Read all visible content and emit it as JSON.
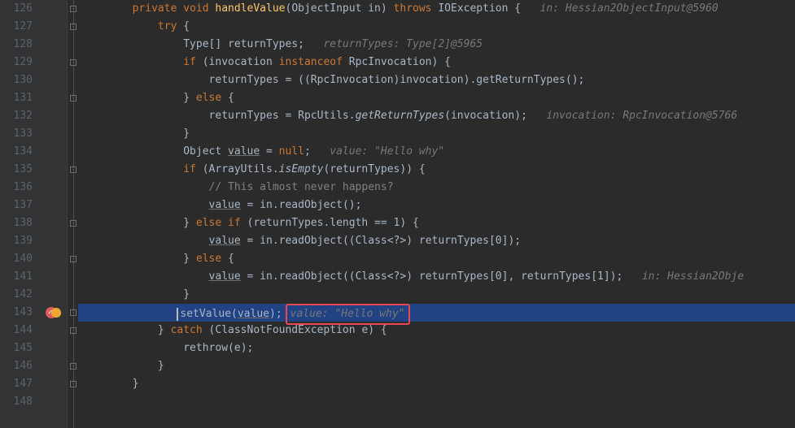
{
  "editor": {
    "first_line": 126,
    "last_line": 148,
    "breakpoint_line": 143,
    "caret_line": 143,
    "lines": {
      "126": {
        "indent": 8,
        "tokens": [
          [
            "kw",
            "private"
          ],
          [
            "pun",
            " "
          ],
          [
            "kw",
            "void"
          ],
          [
            "pun",
            " "
          ],
          [
            "method-decl",
            "handleValue"
          ],
          [
            "pun",
            "("
          ],
          [
            "type",
            "ObjectInput"
          ],
          [
            "pun",
            " "
          ],
          [
            "param",
            "in"
          ],
          [
            "pun",
            ") "
          ],
          [
            "kw",
            "throws"
          ],
          [
            "pun",
            " "
          ],
          [
            "type",
            "IOException"
          ],
          [
            "pun",
            " {   "
          ]
        ],
        "hint": "in: Hessian2ObjectInput@5960"
      },
      "127": {
        "indent": 12,
        "tokens": [
          [
            "kw",
            "try"
          ],
          [
            "pun",
            " {"
          ]
        ]
      },
      "128": {
        "indent": 16,
        "tokens": [
          [
            "type",
            "Type"
          ],
          [
            "pun",
            "[] "
          ],
          [
            "ident",
            "returnTypes"
          ],
          [
            "pun",
            ";   "
          ]
        ],
        "hint": "returnTypes: Type[2]@5965"
      },
      "129": {
        "indent": 16,
        "tokens": [
          [
            "kw",
            "if"
          ],
          [
            "pun",
            " ("
          ],
          [
            "ident",
            "invocation"
          ],
          [
            "pun",
            " "
          ],
          [
            "kw",
            "instanceof"
          ],
          [
            "pun",
            " "
          ],
          [
            "type",
            "RpcInvocation"
          ],
          [
            "pun",
            ") {"
          ]
        ]
      },
      "130": {
        "indent": 20,
        "tokens": [
          [
            "ident",
            "returnTypes"
          ],
          [
            "pun",
            " = (("
          ],
          [
            "type",
            "RpcInvocation"
          ],
          [
            "pun",
            ")"
          ],
          [
            "ident",
            "invocation"
          ],
          [
            "pun",
            ")."
          ],
          [
            "method-call",
            "getReturnTypes"
          ],
          [
            "pun",
            "();"
          ]
        ]
      },
      "131": {
        "indent": 16,
        "tokens": [
          [
            "pun",
            "} "
          ],
          [
            "kw",
            "else"
          ],
          [
            "pun",
            " {"
          ]
        ]
      },
      "132": {
        "indent": 20,
        "tokens": [
          [
            "ident",
            "returnTypes"
          ],
          [
            "pun",
            " = "
          ],
          [
            "type",
            "RpcUtils"
          ],
          [
            "pun",
            "."
          ],
          [
            "method-static",
            "getReturnTypes"
          ],
          [
            "pun",
            "("
          ],
          [
            "ident",
            "invocation"
          ],
          [
            "pun",
            ");   "
          ]
        ],
        "hint": "invocation: RpcInvocation@5766"
      },
      "133": {
        "indent": 16,
        "tokens": [
          [
            "pun",
            "}"
          ]
        ]
      },
      "134": {
        "indent": 16,
        "tokens": [
          [
            "type",
            "Object"
          ],
          [
            "pun",
            " "
          ],
          [
            "ident-u",
            "value"
          ],
          [
            "pun",
            " = "
          ],
          [
            "kw",
            "null"
          ],
          [
            "pun",
            ";   "
          ]
        ],
        "hint": "value: \"Hello why\""
      },
      "135": {
        "indent": 16,
        "tokens": [
          [
            "kw",
            "if"
          ],
          [
            "pun",
            " ("
          ],
          [
            "type",
            "ArrayUtils"
          ],
          [
            "pun",
            "."
          ],
          [
            "method-static",
            "isEmpty"
          ],
          [
            "pun",
            "("
          ],
          [
            "ident",
            "returnTypes"
          ],
          [
            "pun",
            ")) {"
          ]
        ]
      },
      "136": {
        "indent": 20,
        "tokens": [
          [
            "comment",
            "// This almost never happens?"
          ]
        ]
      },
      "137": {
        "indent": 20,
        "tokens": [
          [
            "ident-u",
            "value"
          ],
          [
            "pun",
            " = "
          ],
          [
            "ident",
            "in"
          ],
          [
            "pun",
            "."
          ],
          [
            "method-call",
            "readObject"
          ],
          [
            "pun",
            "();"
          ]
        ]
      },
      "138": {
        "indent": 16,
        "tokens": [
          [
            "pun",
            "} "
          ],
          [
            "kw",
            "else if"
          ],
          [
            "pun",
            " ("
          ],
          [
            "ident",
            "returnTypes"
          ],
          [
            "pun",
            "."
          ],
          [
            "ident",
            "length"
          ],
          [
            "pun",
            " == "
          ],
          [
            "num",
            "1"
          ],
          [
            "pun",
            ") {"
          ]
        ]
      },
      "139": {
        "indent": 20,
        "tokens": [
          [
            "ident-u",
            "value"
          ],
          [
            "pun",
            " = "
          ],
          [
            "ident",
            "in"
          ],
          [
            "pun",
            "."
          ],
          [
            "method-call",
            "readObject"
          ],
          [
            "pun",
            "(("
          ],
          [
            "type",
            "Class<?>"
          ],
          [
            "pun",
            ") "
          ],
          [
            "ident",
            "returnTypes"
          ],
          [
            "pun",
            "["
          ],
          [
            "num",
            "0"
          ],
          [
            "pun",
            "]);"
          ]
        ]
      },
      "140": {
        "indent": 16,
        "tokens": [
          [
            "pun",
            "} "
          ],
          [
            "kw",
            "else"
          ],
          [
            "pun",
            " {"
          ]
        ]
      },
      "141": {
        "indent": 20,
        "tokens": [
          [
            "ident-u",
            "value"
          ],
          [
            "pun",
            " = "
          ],
          [
            "ident",
            "in"
          ],
          [
            "pun",
            "."
          ],
          [
            "method-call",
            "readObject"
          ],
          [
            "pun",
            "(("
          ],
          [
            "type",
            "Class<?>"
          ],
          [
            "pun",
            ") "
          ],
          [
            "ident",
            "returnTypes"
          ],
          [
            "pun",
            "["
          ],
          [
            "num",
            "0"
          ],
          [
            "pun",
            "], "
          ],
          [
            "ident",
            "returnTypes"
          ],
          [
            "pun",
            "["
          ],
          [
            "num",
            "1"
          ],
          [
            "pun",
            "]);   "
          ]
        ],
        "hint": "in: Hessian2Obje"
      },
      "142": {
        "indent": 16,
        "tokens": [
          [
            "pun",
            "}"
          ]
        ]
      },
      "143": {
        "indent": 16,
        "tokens": [
          [
            "method-call",
            "setValue"
          ],
          [
            "pun",
            "("
          ],
          [
            "ident-u",
            "value"
          ],
          [
            "pun",
            ");"
          ]
        ],
        "boxhint": "value: \"Hello why\"",
        "highlighted": true,
        "caret": true
      },
      "144": {
        "indent": 12,
        "tokens": [
          [
            "pun",
            "} "
          ],
          [
            "kw",
            "catch"
          ],
          [
            "pun",
            " ("
          ],
          [
            "type",
            "ClassNotFoundException"
          ],
          [
            "pun",
            " "
          ],
          [
            "param",
            "e"
          ],
          [
            "pun",
            ") {"
          ]
        ]
      },
      "145": {
        "indent": 16,
        "tokens": [
          [
            "method-call",
            "rethrow"
          ],
          [
            "pun",
            "("
          ],
          [
            "ident",
            "e"
          ],
          [
            "pun",
            ");"
          ]
        ]
      },
      "146": {
        "indent": 12,
        "tokens": [
          [
            "pun",
            "}"
          ]
        ]
      },
      "147": {
        "indent": 8,
        "tokens": [
          [
            "pun",
            "}"
          ]
        ]
      },
      "148": {
        "indent": 0,
        "tokens": []
      }
    }
  },
  "fold_markers": [
    126,
    127,
    129,
    131,
    135,
    138,
    140,
    143,
    144,
    146,
    147
  ],
  "colors": {
    "bg": "#2b2b2b",
    "gutter": "#313335",
    "highlight": "#214283",
    "keyword": "#cc7832",
    "method_decl": "#ffc66d",
    "comment": "#808080",
    "hint": "#787878",
    "box": "#e74856"
  }
}
